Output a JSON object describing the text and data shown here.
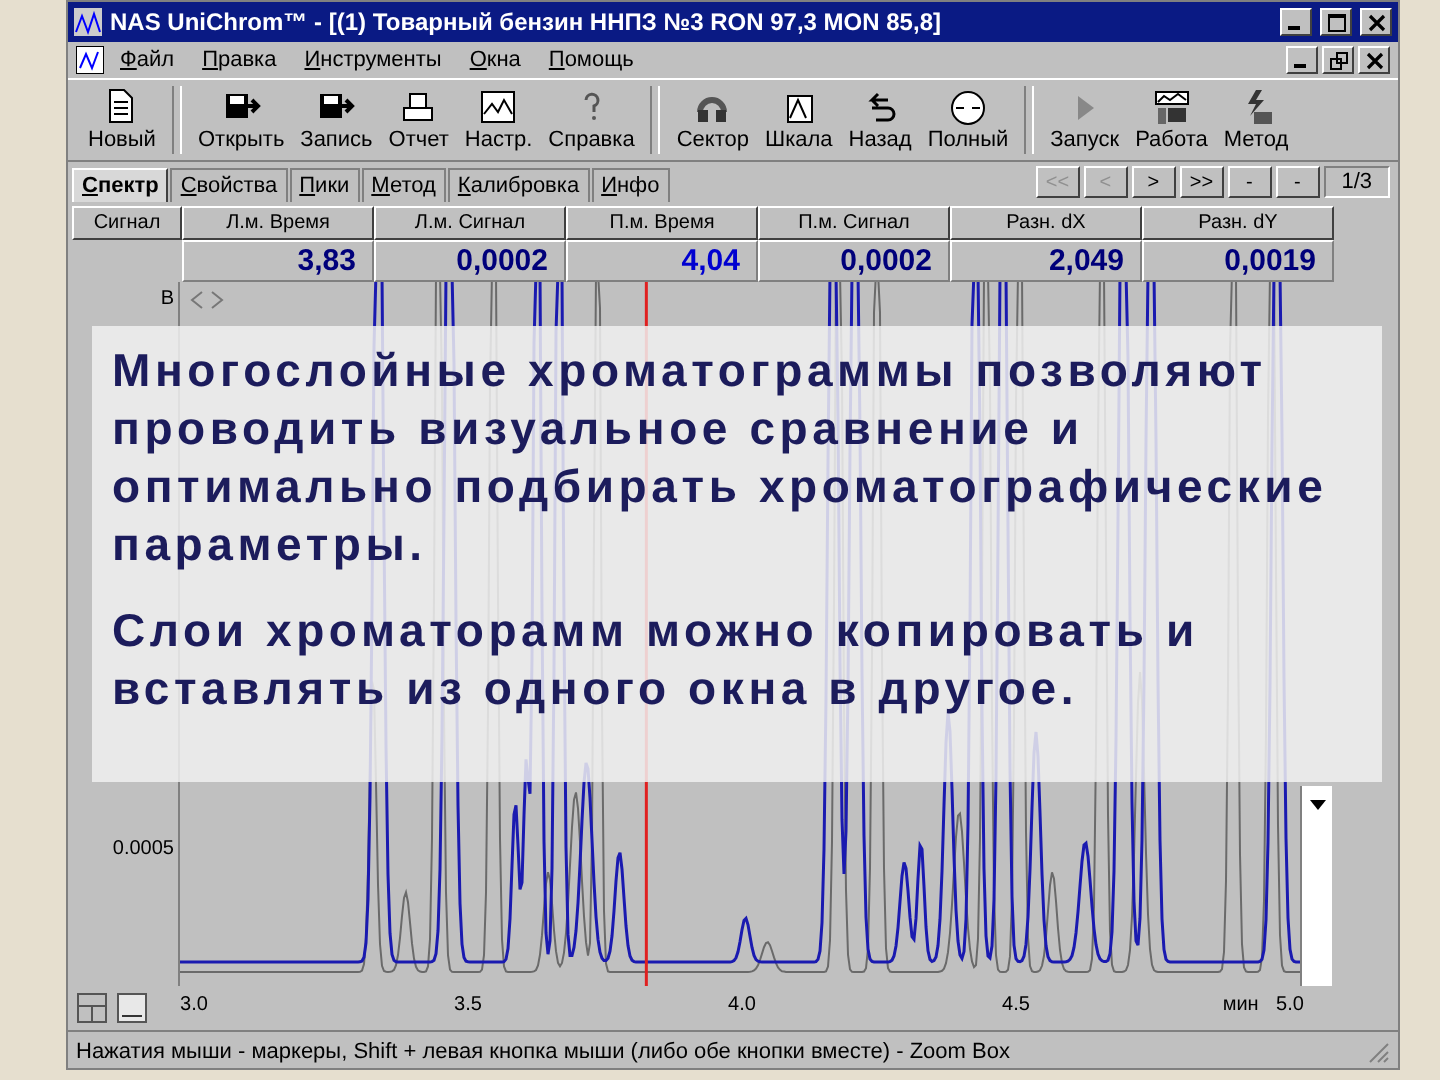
{
  "window": {
    "title": "NAS UniChrom™ - [(1) Товарный бензин ННПЗ №3 RON 97,3 MON 85,8]"
  },
  "menu": [
    "Файл",
    "Правка",
    "Инструменты",
    "Окна",
    "Помощь"
  ],
  "toolbar": [
    {
      "label": "Новый",
      "group_start": false
    },
    {
      "label": "Открыть",
      "group_start": true
    },
    {
      "label": "Запись",
      "group_start": false
    },
    {
      "label": "Отчет",
      "group_start": false
    },
    {
      "label": "Настр.",
      "group_start": false
    },
    {
      "label": "Справка",
      "group_start": false
    },
    {
      "label": "Сектор",
      "group_start": true
    },
    {
      "label": "Шкала",
      "group_start": false
    },
    {
      "label": "Назад",
      "group_start": false
    },
    {
      "label": "Полный",
      "group_start": false
    },
    {
      "label": "Запуск",
      "group_start": true
    },
    {
      "label": "Работа",
      "group_start": false
    },
    {
      "label": "Метод",
      "group_start": false
    }
  ],
  "tabs": [
    {
      "label": "Спектр",
      "selected": true
    },
    {
      "label": "Свойства",
      "selected": false
    },
    {
      "label": "Пики",
      "selected": false
    },
    {
      "label": "Метод",
      "selected": false
    },
    {
      "label": "Калибровка",
      "selected": false
    },
    {
      "label": "Инфо",
      "selected": false
    }
  ],
  "nav_buttons": [
    {
      "label": "<<",
      "disabled": true
    },
    {
      "label": "<",
      "disabled": true
    },
    {
      "label": ">",
      "disabled": false
    },
    {
      "label": ">>",
      "disabled": false
    },
    {
      "label": "-",
      "disabled": false
    },
    {
      "label": "-",
      "disabled": false
    }
  ],
  "page_indicator": "1/3",
  "table": {
    "columns": [
      "Сигнал",
      "Л.м. Время",
      "Л.м. Сигнал",
      "П.м. Время",
      "П.м. Сигнал",
      "Разн. dX",
      "Разн. dY"
    ],
    "values": [
      "3,83",
      "0,0002",
      "4,04",
      "0,0002",
      "2,049",
      "0,0019"
    ]
  },
  "chart": {
    "y_labels": [
      "B",
      "0.0005"
    ],
    "x_labels": [
      "3.0",
      "3.5",
      "4.0",
      "4.5",
      "мин",
      "5.0"
    ]
  },
  "overlay": {
    "paragraphs": [
      "Многослойные хроматограммы позволяют проводить визуальное сравнение и оптимально подбирать хроматографические параметры.",
      "Слои хроматорамм можно копировать и вставлять из одного окна в другое."
    ]
  },
  "status_bar": "Нажатия мыши - маркеры, Shift + левая кнопка мыши  (либо обе кнопки вместе) - Zoom Box"
}
